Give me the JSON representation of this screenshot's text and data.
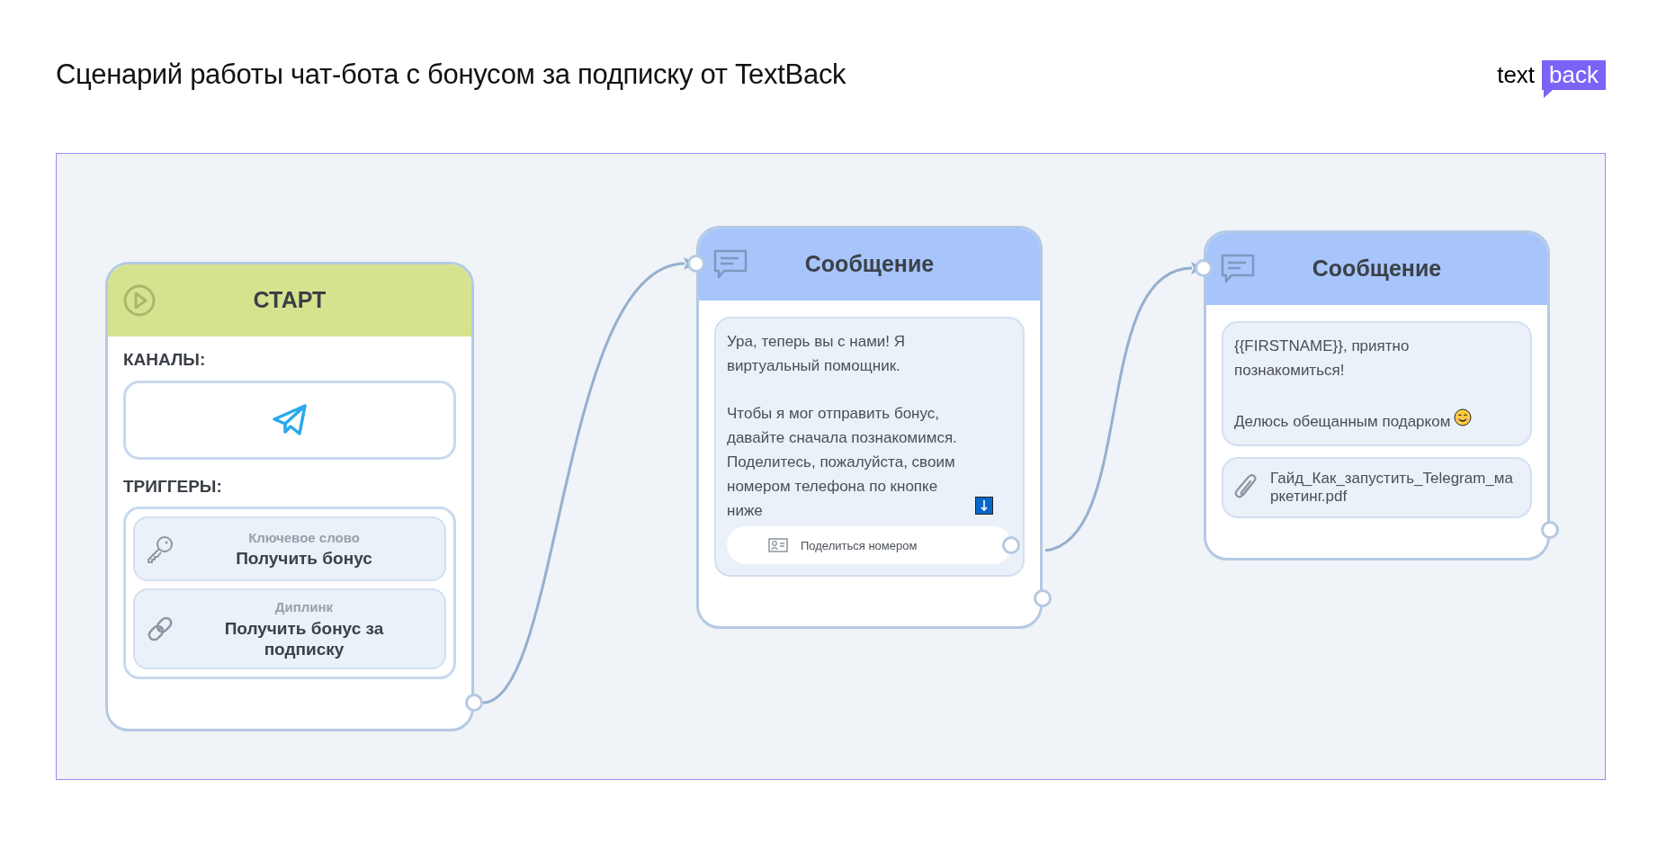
{
  "title": "Сценарий работы чат-бота с бонусом за подписку от TextBack",
  "logo": {
    "word_1": "text",
    "word_2": "back"
  },
  "nodes": [
    {
      "kind": "start",
      "title": "СТАРТ",
      "channels_label": "КАНАЛЫ:",
      "channels": [
        {
          "kind": "telegram"
        }
      ],
      "triggers_label": "ТРИГГЕРЫ:",
      "triggers": [
        {
          "kind": "keyword",
          "type_label": "Ключевое слово",
          "value": "Получить бонус"
        },
        {
          "kind": "deeplink",
          "type_label": "Диплинк",
          "value": "Получить бонус за подписку"
        }
      ]
    },
    {
      "kind": "message",
      "title": "Сообщение",
      "blocks": [
        {
          "kind": "text",
          "paragraphs": [
            {
              "kind": "plain",
              "text": "Ура, теперь вы с нами! Я виртуальный помощник."
            },
            {
              "kind": "down_arrow",
              "text": "Чтобы я мог отправить бонус, давайте сначала познакомимся. Поделитесь, пожалуйста, своим номером телефона по кнопке ниже"
            }
          ],
          "buttons": [
            {
              "kind": "contact",
              "label": "Поделиться номером"
            }
          ]
        }
      ]
    },
    {
      "kind": "message",
      "title": "Сообщение",
      "blocks": [
        {
          "kind": "text",
          "paragraphs": [
            {
              "kind": "plain",
              "text": "{{FIRSTNAME}}, приятно познакомиться!"
            },
            {
              "kind": "smile",
              "text": "Делюсь обещанным подарком"
            }
          ]
        },
        {
          "kind": "file",
          "name": "Гайд_Как_запустить_Telegram_маркетинг.pdf"
        }
      ]
    }
  ]
}
